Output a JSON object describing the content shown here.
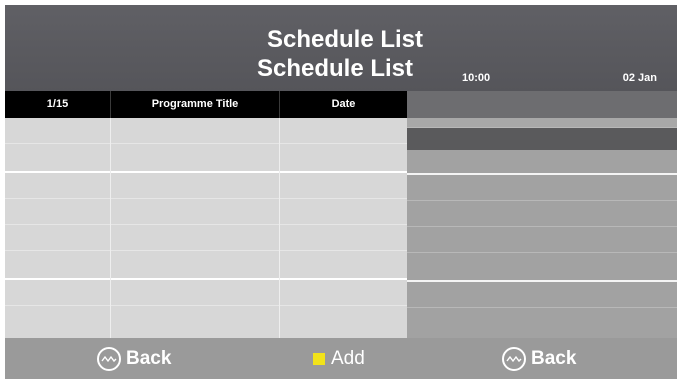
{
  "header": {
    "title": "Schedule List",
    "subtitle": "Schedule List",
    "time": "10:00",
    "date": "02 Jan"
  },
  "columns": {
    "page": "1/15",
    "programme_title": "Programme Title",
    "date": "Date"
  },
  "footer": {
    "left_label": "Back",
    "middle_label": "Add",
    "right_label": "Back",
    "left_icon": "back-key-icon",
    "middle_icon": "yellow-key-icon",
    "right_icon": "back-key-icon"
  },
  "colors": {
    "yellow_key": "#f2e31a",
    "panel_grey": "#a2a2a2",
    "list_grey": "#d7d7d7"
  }
}
